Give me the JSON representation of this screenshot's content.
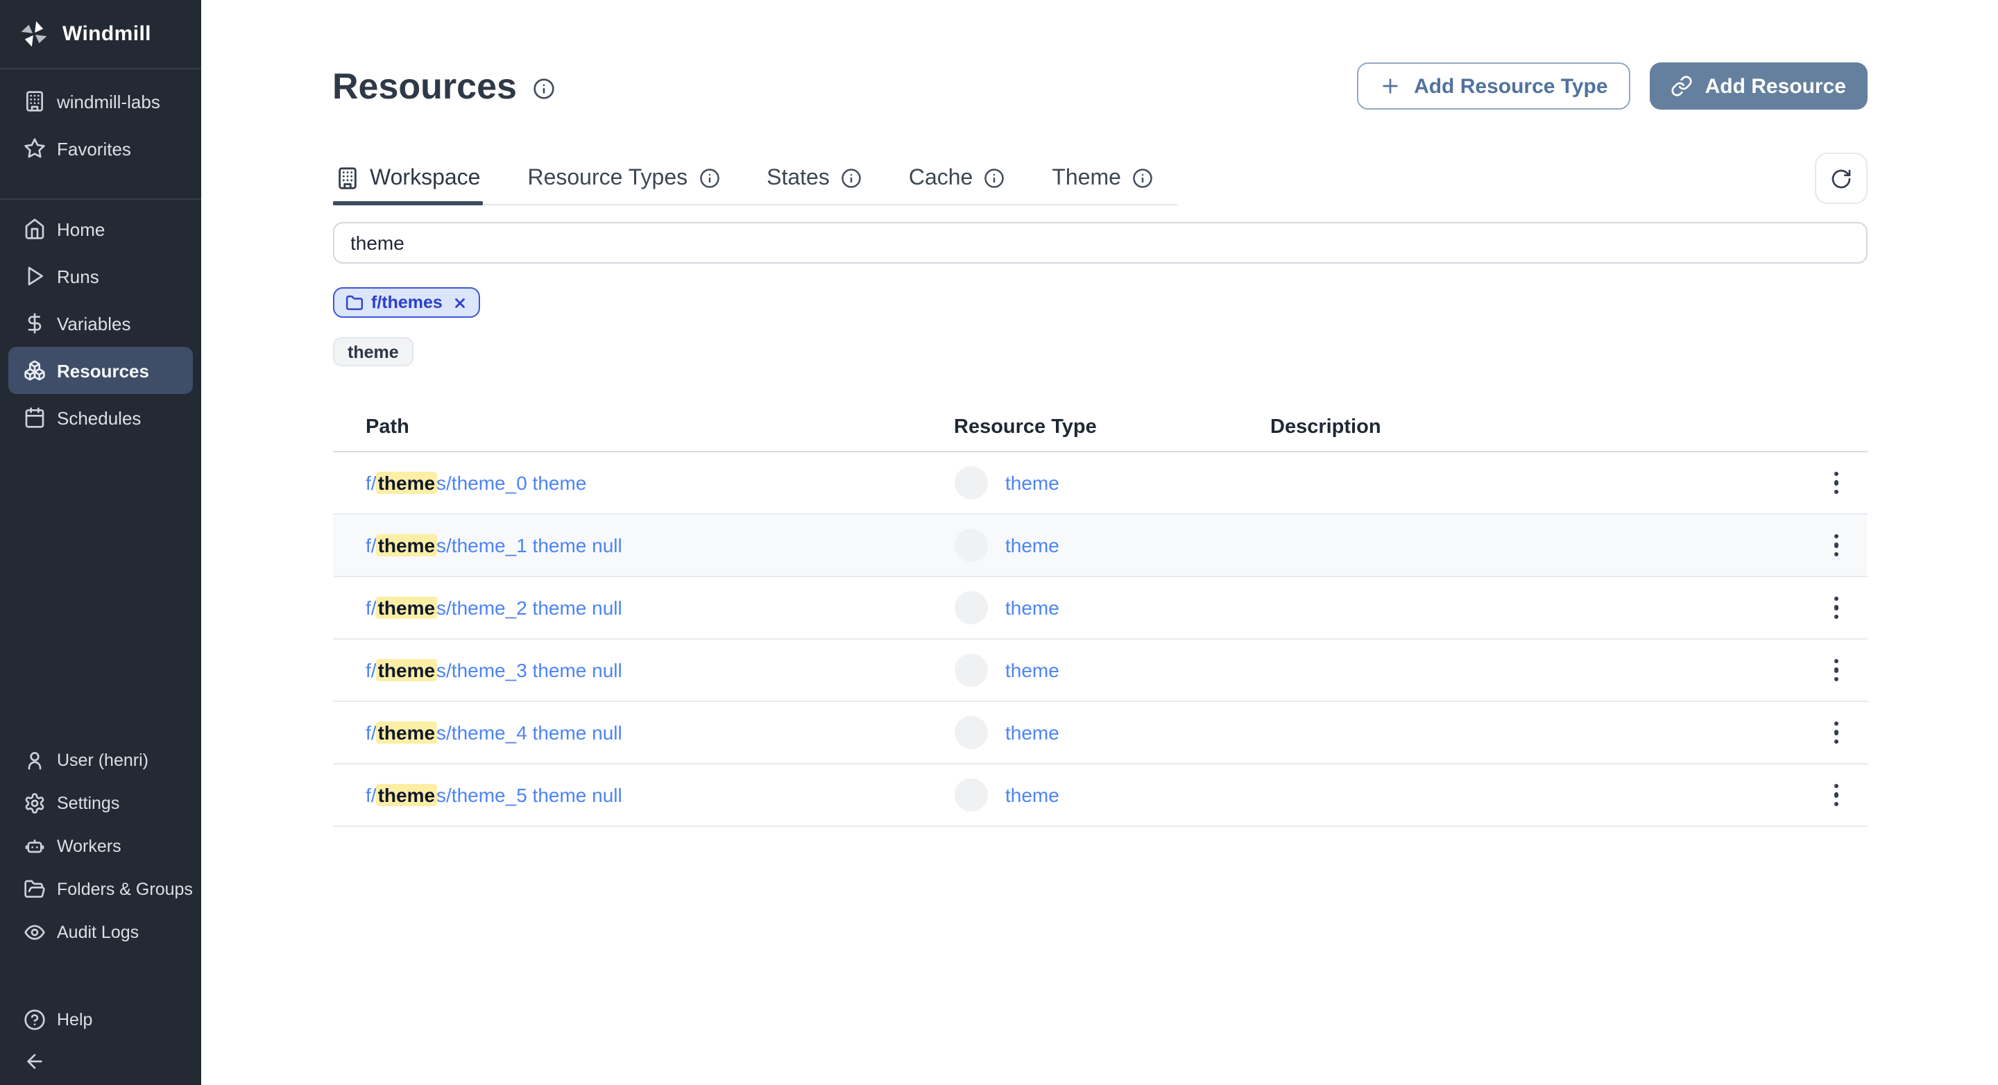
{
  "app_name": "Windmill",
  "sidebar": {
    "workspace_group": [
      {
        "label": "windmill-labs"
      },
      {
        "label": "Favorites"
      }
    ],
    "nav": [
      {
        "label": "Home",
        "active": false
      },
      {
        "label": "Runs",
        "active": false
      },
      {
        "label": "Variables",
        "active": false
      },
      {
        "label": "Resources",
        "active": true
      },
      {
        "label": "Schedules",
        "active": false
      }
    ],
    "bottom": [
      {
        "label": "User (henri)"
      },
      {
        "label": "Settings"
      },
      {
        "label": "Workers"
      },
      {
        "label": "Folders & Groups"
      },
      {
        "label": "Audit Logs"
      }
    ],
    "help_label": "Help"
  },
  "header": {
    "title": "Resources",
    "add_resource_type_label": "Add Resource Type",
    "add_resource_label": "Add Resource"
  },
  "tabs": [
    {
      "label": "Workspace",
      "active": true,
      "has_info": false
    },
    {
      "label": "Resource Types",
      "active": false,
      "has_info": true
    },
    {
      "label": "States",
      "active": false,
      "has_info": true
    },
    {
      "label": "Cache",
      "active": false,
      "has_info": true
    },
    {
      "label": "Theme",
      "active": false,
      "has_info": true
    }
  ],
  "search": {
    "value": "theme"
  },
  "filters": {
    "folder_chip_label": "f/themes",
    "text_chip_label": "theme"
  },
  "table": {
    "columns": [
      "Path",
      "Resource Type",
      "Description"
    ],
    "rows": [
      {
        "path_prefix": "f/",
        "path_highlight": "theme",
        "path_rest": "s/theme_0 theme",
        "resource_type": "theme",
        "description": "",
        "hovered": false
      },
      {
        "path_prefix": "f/",
        "path_highlight": "theme",
        "path_rest": "s/theme_1 theme null",
        "resource_type": "theme",
        "description": "",
        "hovered": true
      },
      {
        "path_prefix": "f/",
        "path_highlight": "theme",
        "path_rest": "s/theme_2 theme null",
        "resource_type": "theme",
        "description": "",
        "hovered": false
      },
      {
        "path_prefix": "f/",
        "path_highlight": "theme",
        "path_rest": "s/theme_3 theme null",
        "resource_type": "theme",
        "description": "",
        "hovered": false
      },
      {
        "path_prefix": "f/",
        "path_highlight": "theme",
        "path_rest": "s/theme_4 theme null",
        "resource_type": "theme",
        "description": "",
        "hovered": false
      },
      {
        "path_prefix": "f/",
        "path_highlight": "theme",
        "path_rest": "s/theme_5 theme null",
        "resource_type": "theme",
        "description": "",
        "hovered": false
      }
    ]
  },
  "colors": {
    "sidebar_bg": "#242a34",
    "sidebar_active_bg": "#3f4d68",
    "primary_button_bg": "#64809e",
    "outline_button_text": "#50739f",
    "link_blue": "#4c84f6",
    "highlight_yellow": "#fcefa5",
    "chip_folder_bg": "#dbe5fc",
    "chip_folder_border": "#3d57d8"
  }
}
